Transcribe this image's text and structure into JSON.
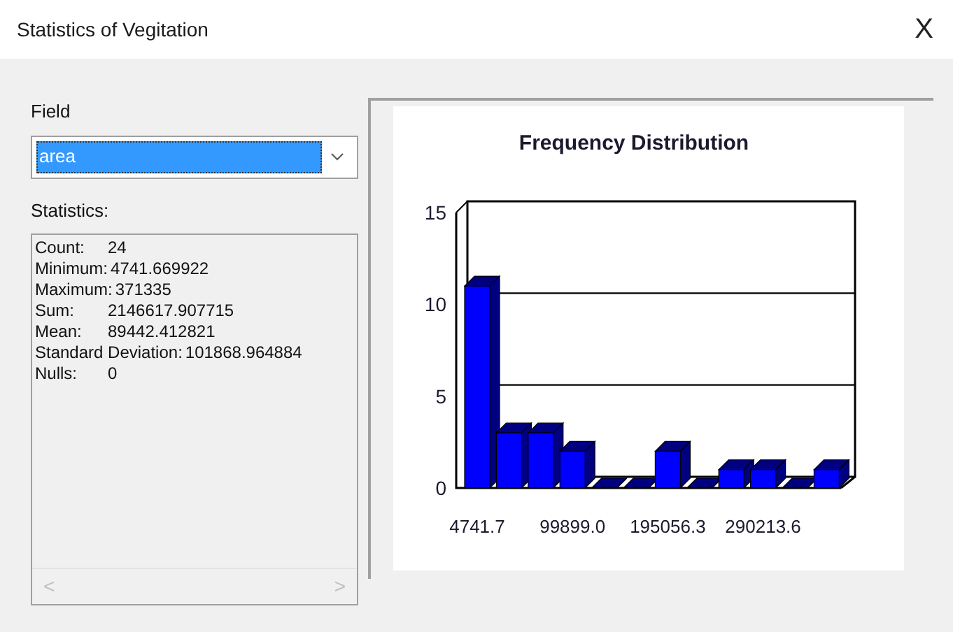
{
  "window": {
    "title": "Statistics of Vegitation",
    "close": "X"
  },
  "field": {
    "label": "Field",
    "value": "area"
  },
  "statistics": {
    "label": "Statistics:",
    "rows": [
      {
        "label": "Count:",
        "value": "24"
      },
      {
        "label": "Minimum:",
        "value": "4741.669922"
      },
      {
        "label": "Maximum:",
        "value": "371335"
      },
      {
        "label": "Sum:",
        "value": "2146617.907715"
      },
      {
        "label": "Mean:",
        "value": "89442.412821"
      },
      {
        "label": "Standard Deviation:",
        "value": "101868.964884"
      },
      {
        "label": "Nulls:",
        "value": "0"
      }
    ],
    "scroll_left": "<",
    "scroll_right": ">"
  },
  "chart": {
    "chart_data": {
      "type": "bar",
      "title": "Frequency Distribution",
      "categories": [
        "4741.7",
        null,
        null,
        "99899.0",
        null,
        null,
        "195056.3",
        null,
        null,
        "290213.6",
        null,
        null
      ],
      "values": [
        11,
        3,
        3,
        2,
        0,
        0,
        2,
        0,
        1,
        1,
        0,
        1
      ],
      "ylim": [
        0,
        15
      ],
      "yticks": [
        0,
        5,
        10,
        15
      ]
    }
  }
}
